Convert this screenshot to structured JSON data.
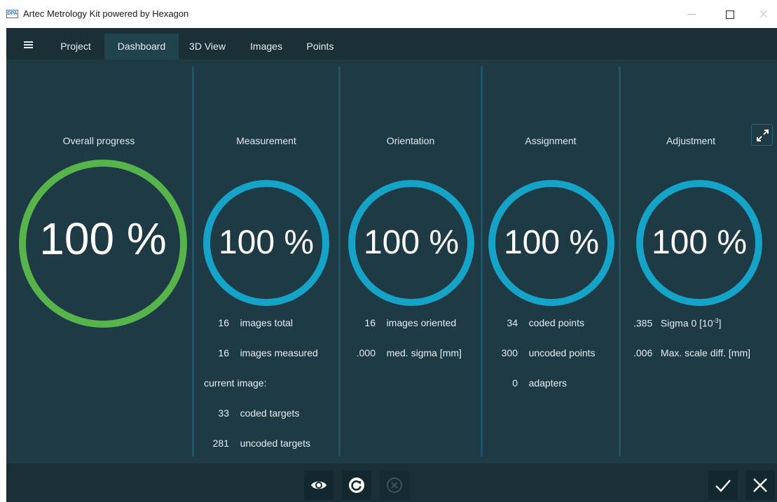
{
  "window": {
    "title": "Artec Metrology Kit powered by Hexagon",
    "logo_text": "DPA"
  },
  "tabs": [
    "Project",
    "Dashboard",
    "3D View",
    "Images",
    "Points"
  ],
  "active_tab": "Dashboard",
  "overall": {
    "title": "Overall progress",
    "percent": "100 %",
    "progress": 1.0,
    "ring_color": "#56b44a"
  },
  "measurement": {
    "title": "Measurement",
    "percent": "100 %",
    "progress": 1.0,
    "ring_color": "#15a3c7",
    "stats": [
      {
        "value": "16",
        "label": "images total"
      },
      {
        "value": "16",
        "label": "images measured"
      },
      {
        "value": "",
        "label": "current image:"
      },
      {
        "value": "33",
        "label": "coded targets"
      },
      {
        "value": "281",
        "label": "uncoded targets"
      }
    ]
  },
  "orientation": {
    "title": "Orientation",
    "percent": "100 %",
    "progress": 1.0,
    "ring_color": "#15a3c7",
    "stats": [
      {
        "value": "16",
        "label": "images oriented"
      },
      {
        "value": ".000",
        "label": "med. sigma  [mm]"
      }
    ]
  },
  "assignment": {
    "title": "Assignment",
    "percent": "100 %",
    "progress": 1.0,
    "ring_color": "#15a3c7",
    "stats": [
      {
        "value": "34",
        "label": "coded points"
      },
      {
        "value": "300",
        "label": "uncoded points"
      },
      {
        "value": "0",
        "label": "adapters"
      }
    ]
  },
  "adjustment": {
    "title": "Adjustment",
    "percent": "100 %",
    "progress": 1.0,
    "ring_color": "#15a3c7",
    "stats": [
      {
        "value": ".385",
        "label": "Sigma 0 [10",
        "sup": "-3",
        "tail": "]"
      },
      {
        "value": ".006",
        "label": "Max. scale diff.  [mm]"
      }
    ]
  },
  "colors": {
    "background": "#1d3a45",
    "bar": "#1b2f36",
    "ring_done": "#56b44a",
    "ring_section": "#15a3c7"
  },
  "icons": {
    "menu": "hamburger-icon",
    "expand": "expand-icon",
    "view": "eye-icon",
    "refresh": "refresh-icon",
    "cancel": "cancel-circle-icon",
    "accept": "check-icon",
    "close": "close-icon"
  }
}
